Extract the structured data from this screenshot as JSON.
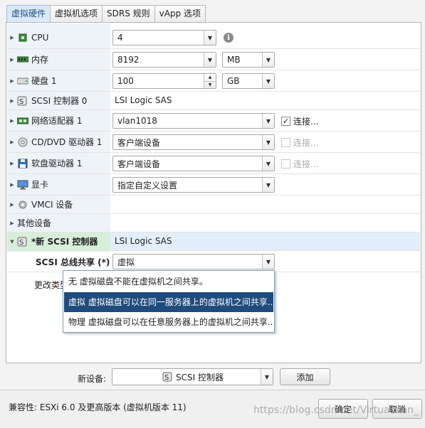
{
  "tabs": [
    {
      "label": "虚拟硬件",
      "active": true
    },
    {
      "label": "虚拟机选项"
    },
    {
      "label": "SDRS 规则"
    },
    {
      "label": "vApp 选项"
    }
  ],
  "hardware": {
    "cpu": {
      "label": "CPU",
      "value": "4"
    },
    "memory": {
      "label": "内存",
      "value": "8192",
      "unit": "MB"
    },
    "disk": {
      "label": "硬盘 1",
      "value": "100",
      "unit": "GB"
    },
    "scsi0": {
      "label": "SCSI 控制器 0",
      "value": "LSI Logic SAS"
    },
    "nic": {
      "label": "网络适配器 1",
      "value": "vlan1018",
      "connect_label": "连接...",
      "connected": true
    },
    "cdrom": {
      "label": "CD/DVD 驱动器 1",
      "value": "客户端设备",
      "connect_label": "连接..."
    },
    "floppy": {
      "label": "软盘驱动器 1",
      "value": "客户端设备",
      "connect_label": "连接..."
    },
    "video": {
      "label": "显卡",
      "value": "指定自定义设置"
    },
    "vmci": {
      "label": "VMCI 设备"
    },
    "other": {
      "label": "其他设备"
    },
    "new_scsi": {
      "label": "*新 SCSI 控制器",
      "value": "LSI Logic SAS",
      "bus_sharing_label": "SCSI 总线共享 (*)",
      "bus_sharing_value": "虚拟",
      "change_type_label": "更改类型"
    }
  },
  "bus_sharing_options": [
    {
      "label": "无    虚拟磁盘不能在虚拟机之间共享。"
    },
    {
      "label": "虚拟 虚拟磁盘可以在同一服务器上的虚拟机之间共享...",
      "selected": true
    },
    {
      "label": "物理 虚拟磁盘可以在任意服务器上的虚拟机之间共享..."
    }
  ],
  "new_device": {
    "label": "新设备:",
    "value": "SCSI 控制器",
    "add_label": "添加"
  },
  "footer": {
    "compat": "兼容性: ESXi 6.0 及更高版本 (虚拟机版本 11)",
    "ok_label": "确定",
    "cancel_label": "取消",
    "watermark": "https://blog.csdn.net/VirtualMan_"
  },
  "colors": {
    "selected_option": "#1f4b7d",
    "active_tab": "#dbe9f7"
  }
}
